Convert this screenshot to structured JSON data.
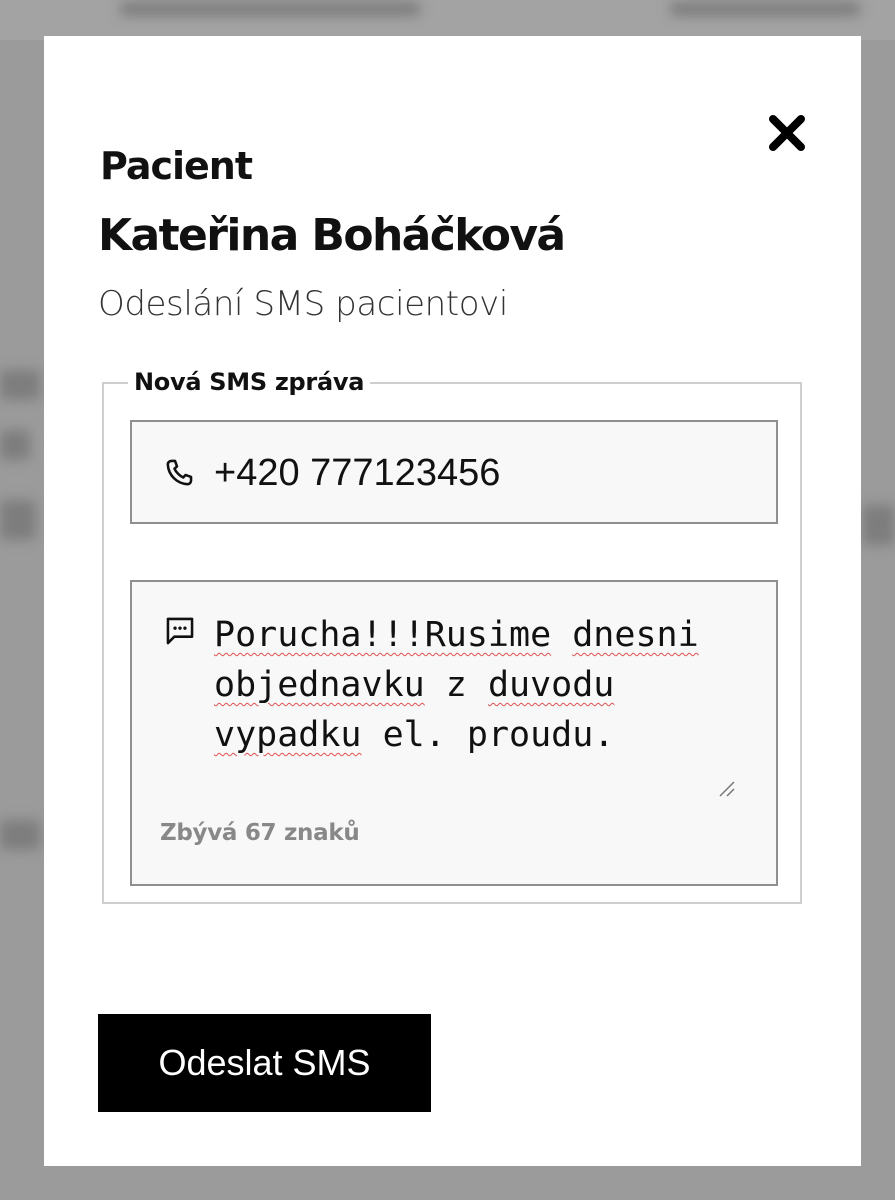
{
  "modal": {
    "heading": "Pacient",
    "close_icon": "close-x-icon",
    "patient_name": "Kateřina Boháčková",
    "subtitle": "Odeslání SMS pacientovi"
  },
  "form": {
    "legend": "Nová SMS zpráva",
    "phone": {
      "icon": "phone-icon",
      "value": "+420 777123456"
    },
    "message": {
      "icon": "message-bubble-icon",
      "words": [
        {
          "text": "Porucha!!!Rusime",
          "misspelled": true
        },
        {
          "text": "dnesni",
          "misspelled": true
        },
        {
          "text": "objednavku",
          "misspelled": true
        },
        {
          "text": "z",
          "misspelled": false
        },
        {
          "text": "duvodu",
          "misspelled": true
        },
        {
          "text": "vypadku",
          "misspelled": true
        },
        {
          "text": "el.",
          "misspelled": false
        },
        {
          "text": "proudu.",
          "misspelled": false
        }
      ],
      "counter": "Zbývá 67 znaků"
    },
    "submit_label": "Odeslat SMS"
  },
  "colors": {
    "overlay": "#9b9b9b",
    "modal_bg": "#ffffff",
    "field_bg": "#f8f8f8",
    "field_border": "#8f8f8f",
    "button_bg": "#000000",
    "counter_text": "#888888",
    "spellcheck": "#e05050"
  }
}
